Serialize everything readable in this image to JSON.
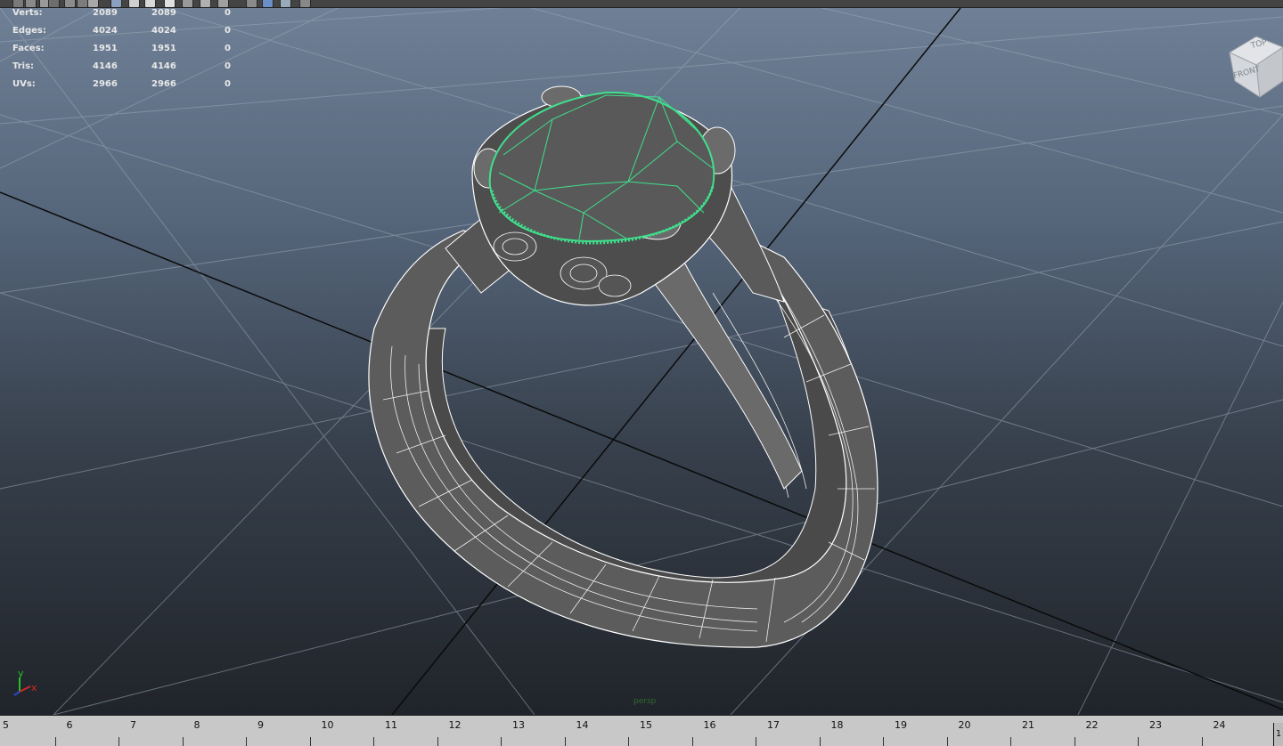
{
  "toolbar": {
    "icons": [
      "select-tool-icon",
      "lasso-tool-icon",
      "paint-tool-icon",
      "move-tool-icon",
      "rotate-tool-icon",
      "scale-tool-icon",
      "camera-icon",
      "grid-icon",
      "wireframe-icon",
      "shaded-icon",
      "textured-icon",
      "light-icon",
      "shadow-icon",
      "xray-icon",
      "isolate-icon",
      "snapshot-icon",
      "render-icon",
      "settings-icon"
    ]
  },
  "hud": {
    "rows": [
      {
        "label": "Verts:",
        "v1": "2089",
        "v2": "2089",
        "v3": "0"
      },
      {
        "label": "Edges:",
        "v1": "4024",
        "v2": "4024",
        "v3": "0"
      },
      {
        "label": "Faces:",
        "v1": "1951",
        "v2": "1951",
        "v3": "0"
      },
      {
        "label": "Tris:",
        "v1": "4146",
        "v2": "4146",
        "v3": "0"
      },
      {
        "label": "UVs:",
        "v1": "2966",
        "v2": "2966",
        "v3": "0"
      }
    ]
  },
  "viewcube": {
    "top": "TOP",
    "front": "FRONT"
  },
  "axes": {
    "y": "y",
    "x": "x"
  },
  "camera": {
    "label": "persp"
  },
  "colors": {
    "selection": "#3fe08c",
    "wire": "#ffffff",
    "mesh": "#5a5a5a",
    "hud_text": "#e8e8e8"
  },
  "timeslider": {
    "frames": [
      "5",
      "6",
      "7",
      "8",
      "9",
      "10",
      "11",
      "12",
      "13",
      "14",
      "15",
      "16",
      "17",
      "18",
      "19",
      "20",
      "21",
      "22",
      "23",
      "24"
    ],
    "end_frame": "1"
  }
}
